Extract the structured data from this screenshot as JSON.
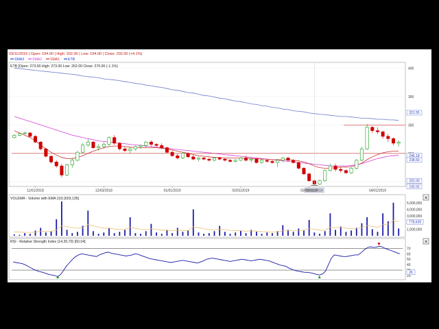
{
  "header": {
    "ohlc_line": "03/11/2019 | Open: 194.00 | High: 202.00 | Low: 194.00 | Close: 202.00 (+4.1%)",
    "legend": [
      {
        "label": "SMA3",
        "color": "#1f3fd6"
      },
      {
        "label": "SMA2",
        "color": "#d63fd6"
      },
      {
        "label": "SMA1",
        "color": "#d62828"
      },
      {
        "label": "ETB",
        "color": "#1f3fd6"
      }
    ],
    "etb_line": "ETB [Open: 273.00  High: 273.00  Low: 262.00  Close: 270.00 (-1.1%)"
  },
  "chart_data": [
    {
      "type": "candlestick",
      "x_tick_labels": [
        "11/01/2018",
        "12/03/2018",
        "01/01/2019",
        "02/01/2019",
        "03/01/2019",
        "04/01/2019"
      ],
      "y_tick_labels": [
        "400",
        "350",
        "300",
        "250",
        "200"
      ],
      "ylim": [
        192,
        410
      ],
      "price_tags": [
        "321.55",
        "246.18",
        "238.50",
        "202.00",
        "192.02"
      ],
      "crosshair_date": "03/11/2019",
      "resistance_level": 300,
      "support_level": 250,
      "ohlc": [
        [
          278,
          284,
          276,
          282
        ],
        [
          282,
          286,
          280,
          285
        ],
        [
          285,
          288,
          283,
          286
        ],
        [
          286,
          287,
          278,
          280
        ],
        [
          280,
          282,
          268,
          270
        ],
        [
          270,
          272,
          255,
          258
        ],
        [
          258,
          260,
          243,
          245
        ],
        [
          245,
          247,
          232,
          235
        ],
        [
          235,
          238,
          225,
          228
        ],
        [
          228,
          232,
          208,
          212
        ],
        [
          212,
          232,
          210,
          230
        ],
        [
          230,
          242,
          225,
          238
        ],
        [
          238,
          255,
          236,
          252
        ],
        [
          252,
          268,
          250,
          265
        ],
        [
          265,
          275,
          262,
          270
        ],
        [
          270,
          272,
          258,
          260
        ],
        [
          260,
          266,
          255,
          262
        ],
        [
          262,
          270,
          258,
          266
        ],
        [
          266,
          280,
          262,
          278
        ],
        [
          278,
          282,
          265,
          268
        ],
        [
          268,
          270,
          255,
          258
        ],
        [
          258,
          262,
          252,
          255
        ],
        [
          255,
          262,
          250,
          258
        ],
        [
          258,
          264,
          255,
          262
        ],
        [
          262,
          266,
          258,
          264
        ],
        [
          264,
          272,
          260,
          270
        ],
        [
          270,
          273,
          262,
          266
        ],
        [
          266,
          268,
          262,
          264
        ],
        [
          264,
          268,
          258,
          260
        ],
        [
          260,
          262,
          250,
          252
        ],
        [
          252,
          255,
          244,
          246
        ],
        [
          246,
          250,
          240,
          242
        ],
        [
          242,
          252,
          240,
          250
        ],
        [
          250,
          252,
          242,
          244
        ],
        [
          244,
          248,
          238,
          240
        ],
        [
          240,
          244,
          236,
          242
        ],
        [
          242,
          244,
          238,
          240
        ],
        [
          240,
          242,
          236,
          238
        ],
        [
          238,
          244,
          236,
          242
        ],
        [
          242,
          244,
          238,
          240
        ],
        [
          240,
          242,
          236,
          238
        ],
        [
          238,
          240,
          234,
          236
        ],
        [
          236,
          240,
          234,
          238
        ],
        [
          238,
          244,
          236,
          242
        ],
        [
          242,
          246,
          236,
          238
        ],
        [
          238,
          242,
          234,
          240
        ],
        [
          240,
          242,
          232,
          234
        ],
        [
          234,
          240,
          232,
          238
        ],
        [
          238,
          240,
          234,
          236
        ],
        [
          236,
          238,
          232,
          234
        ],
        [
          234,
          240,
          226,
          238
        ],
        [
          238,
          244,
          234,
          242
        ],
        [
          242,
          244,
          236,
          238
        ],
        [
          238,
          240,
          232,
          234
        ],
        [
          234,
          236,
          222,
          224
        ],
        [
          224,
          226,
          212,
          214
        ],
        [
          214,
          216,
          200,
          202
        ],
        [
          202,
          204,
          194,
          196
        ],
        [
          196,
          204,
          194,
          202
        ],
        [
          202,
          222,
          200,
          220
        ],
        [
          220,
          232,
          218,
          228
        ],
        [
          228,
          232,
          218,
          222
        ],
        [
          222,
          226,
          216,
          220
        ],
        [
          220,
          222,
          214,
          216
        ],
        [
          216,
          226,
          214,
          224
        ],
        [
          224,
          240,
          222,
          238
        ],
        [
          238,
          262,
          236,
          258
        ],
        [
          258,
          302,
          256,
          296
        ],
        [
          296,
          298,
          286,
          290
        ],
        [
          290,
          296,
          284,
          288
        ],
        [
          288,
          290,
          276,
          280
        ],
        [
          280,
          284,
          270,
          276
        ],
        [
          276,
          278,
          264,
          268
        ],
        [
          268,
          273,
          262,
          270
        ]
      ],
      "sma1": [
        290,
        286,
        282,
        278,
        272,
        265,
        258,
        252,
        247,
        243,
        241,
        241,
        243,
        246,
        250,
        254,
        257,
        260,
        262,
        263,
        263,
        262,
        261,
        260,
        260,
        260,
        260,
        260,
        259,
        258,
        256,
        254,
        252,
        250,
        248,
        246,
        245,
        244,
        243,
        243,
        242,
        242,
        242,
        242,
        242,
        241,
        241,
        240,
        240,
        239,
        239,
        239,
        239,
        238,
        237,
        235,
        232,
        228,
        225,
        224,
        224,
        225,
        226,
        226,
        227,
        229,
        233,
        239,
        244,
        248,
        251,
        253,
        254,
        254
      ],
      "sma2": [
        315,
        312,
        309,
        306,
        303,
        300,
        297,
        294,
        291,
        288,
        285,
        282,
        280,
        278,
        276,
        274,
        272,
        271,
        270,
        269,
        268,
        267,
        266,
        265,
        264,
        263,
        262,
        261,
        260,
        259,
        258,
        257,
        256,
        255,
        254,
        253,
        252,
        251,
        250,
        249,
        248,
        247,
        246,
        245,
        244,
        243,
        242,
        241,
        240,
        239,
        238,
        237,
        236,
        235,
        234,
        233,
        232,
        231,
        230,
        229,
        228,
        228,
        228,
        228,
        229,
        230,
        232,
        235,
        238,
        241,
        243,
        245,
        246,
        247
      ],
      "sma3": [
        400,
        399,
        398,
        397,
        396,
        395,
        394,
        393,
        392,
        391,
        390,
        389,
        388,
        386,
        385,
        384,
        383,
        381,
        380,
        379,
        378,
        376,
        375,
        373,
        372,
        370,
        369,
        367,
        366,
        364,
        362,
        361,
        359,
        357,
        356,
        354,
        352,
        351,
        349,
        347,
        346,
        344,
        342,
        341,
        339,
        337,
        336,
        334,
        333,
        331,
        330,
        328,
        327,
        325,
        324,
        323,
        321,
        320,
        319,
        318,
        317,
        316,
        315,
        315,
        314,
        313,
        312,
        312,
        311,
        310,
        310,
        309,
        309,
        308
      ]
    },
    {
      "type": "bar",
      "title": "VOLEMA - Volume with EMA (10) [603,135]",
      "y_tick_labels": [
        "5,000,000",
        "4,000,000",
        "3,000,000",
        "2,000,000",
        "1,000,000"
      ],
      "last_value_tag": "778,639",
      "ylim": [
        0,
        5600000
      ],
      "volume": [
        200000,
        150000,
        400000,
        300000,
        800000,
        1200000,
        500000,
        700000,
        2500000,
        5200000,
        900000,
        400000,
        600000,
        1500000,
        3800000,
        700000,
        300000,
        500000,
        1200000,
        400000,
        600000,
        900000,
        2800000,
        400000,
        300000,
        700000,
        1800000,
        500000,
        300000,
        900000,
        400000,
        1200000,
        600000,
        800000,
        4000000,
        500000,
        300000,
        400000,
        700000,
        1500000,
        600000,
        300000,
        500000,
        800000,
        400000,
        900000,
        600000,
        300000,
        500000,
        400000,
        700000,
        1600000,
        900000,
        600000,
        1100000,
        800000,
        2400000,
        500000,
        300000,
        700000,
        3400000,
        900000,
        1400000,
        600000,
        800000,
        1200000,
        1900000,
        2800000,
        1000000,
        600000,
        3400000,
        2200000,
        5000000,
        1100000
      ],
      "ema": [
        600000,
        550000,
        520000,
        510000,
        560000,
        680000,
        650000,
        660000,
        900000,
        1500000,
        1400000,
        1250000,
        1150000,
        1200000,
        1700000,
        1500000,
        1300000,
        1150000,
        1160000,
        1020000,
        950000,
        940000,
        1280000,
        1120000,
        970000,
        920000,
        1080000,
        970000,
        850000,
        860000,
        770000,
        850000,
        800000,
        800000,
        1380000,
        1220000,
        1050000,
        930000,
        890000,
        1000000,
        930000,
        820000,
        760000,
        770000,
        700000,
        740000,
        710000,
        640000,
        610000,
        570000,
        590000,
        770000,
        790000,
        760000,
        820000,
        820000,
        1100000,
        990000,
        860000,
        830000,
        1300000,
        1230000,
        1260000,
        1140000,
        1080000,
        1100000,
        1240000,
        1520000,
        1430000,
        1280000,
        1670000,
        1760000,
        2340000,
        2110000
      ]
    },
    {
      "type": "line",
      "title": "RSI - Relative Strength Index (14,30,70) [60.04]",
      "y_tick_labels": [
        "70",
        "60",
        "50",
        "40",
        "30",
        "20"
      ],
      "last_value_tag": "26",
      "levels": [
        30,
        70
      ],
      "ylim": [
        15,
        78
      ],
      "rsi": [
        45,
        44,
        43,
        42,
        40,
        37,
        34,
        31,
        29,
        27,
        26,
        24,
        22,
        21,
        20,
        18,
        22,
        30,
        38,
        44,
        50,
        55,
        58,
        60,
        59,
        58,
        57,
        56,
        55,
        58,
        60,
        62,
        63,
        61,
        60,
        59,
        58,
        57,
        56,
        57,
        58,
        60,
        59,
        57,
        55,
        53,
        51,
        50,
        49,
        48,
        47,
        46,
        45,
        44,
        45,
        46,
        47,
        48,
        47,
        46,
        45,
        44,
        43,
        45,
        47,
        50,
        51,
        52,
        51,
        50,
        49,
        48,
        47,
        46,
        47,
        48,
        49,
        50,
        49,
        48,
        47,
        48,
        49,
        50,
        49,
        48,
        47,
        45,
        43,
        41,
        39,
        38,
        36,
        33,
        31,
        29,
        28,
        27,
        26,
        26,
        25,
        24,
        22,
        21,
        23,
        28,
        40,
        52,
        58,
        57,
        56,
        55,
        55,
        56,
        57,
        58,
        58,
        62,
        67,
        71,
        73,
        72,
        72,
        74,
        73,
        70,
        68,
        66,
        64,
        62,
        60
      ]
    }
  ]
}
